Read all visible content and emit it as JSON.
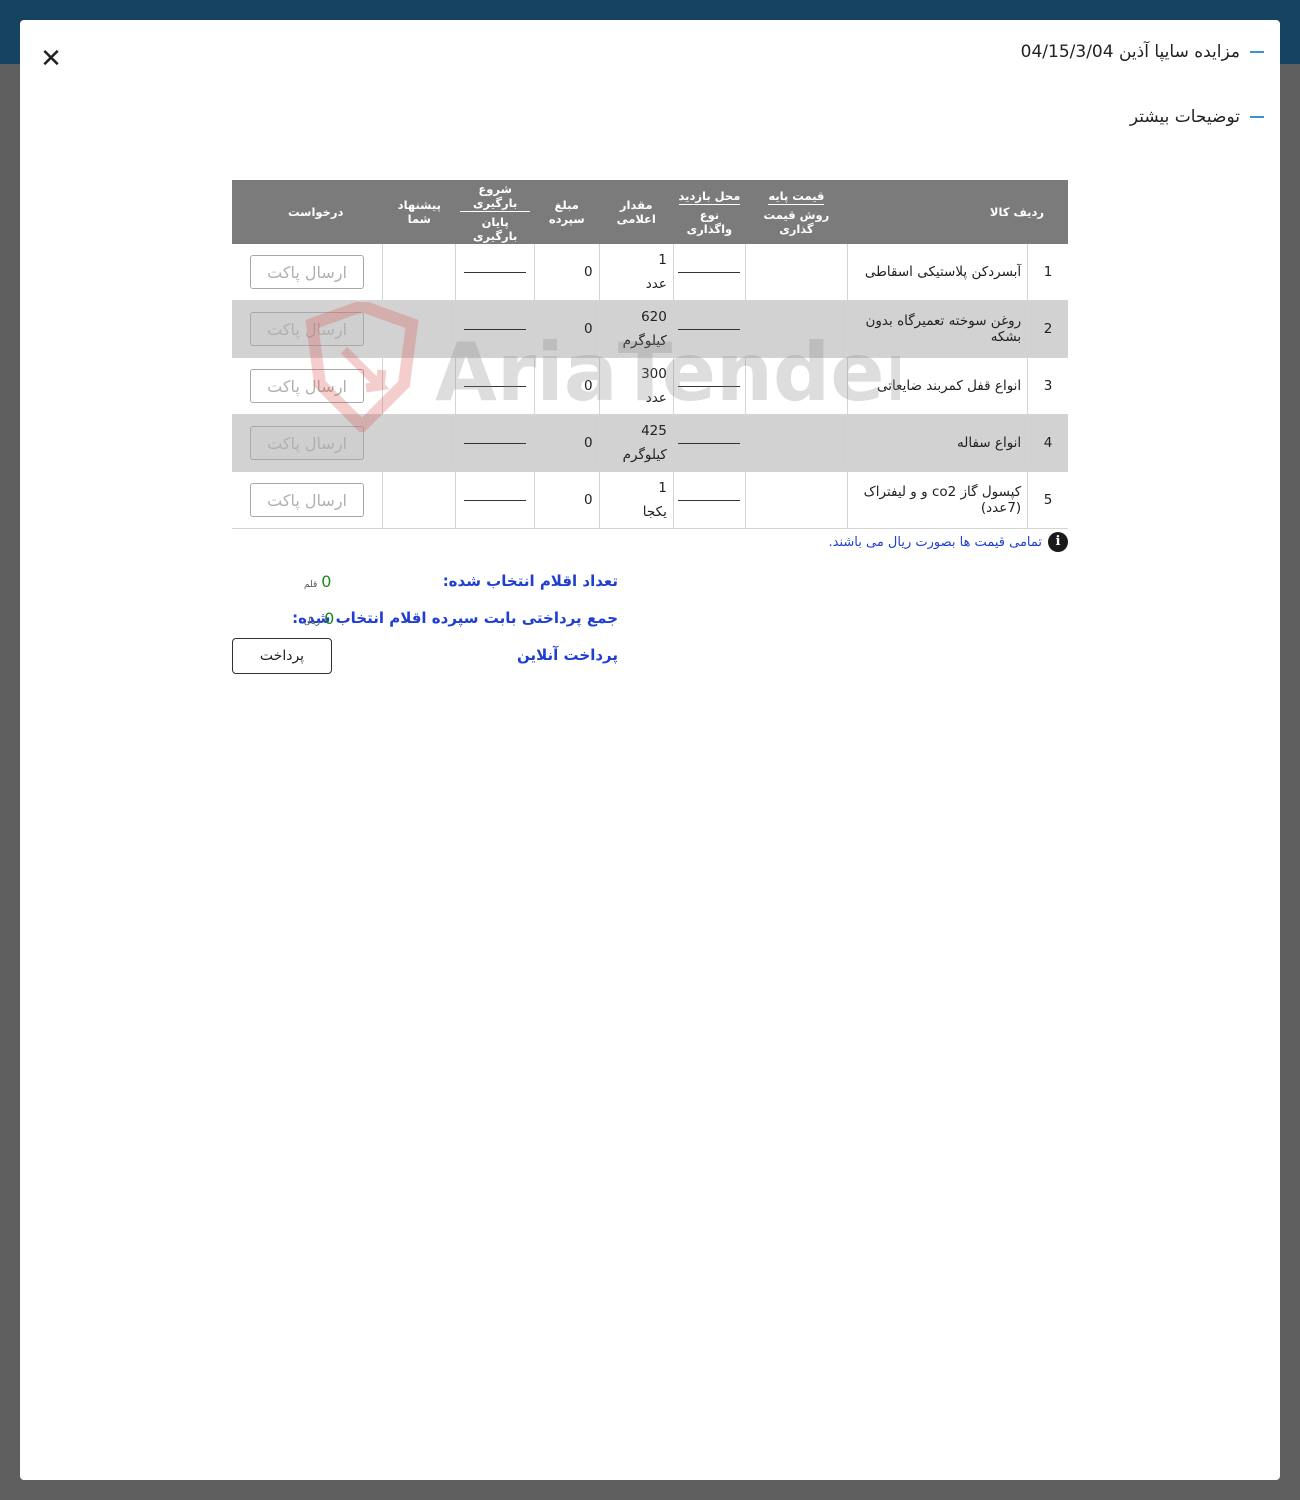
{
  "header": {
    "title": "مزایده سایپا آذین 04/15/3/04",
    "subtitle": "توضیحات بیشتر"
  },
  "table": {
    "headers": {
      "row_item": "ردیف کالا",
      "base_price": "قیمت پایه",
      "pricing_method": "روش قیمت گذاری",
      "visit_place": "محل بازدید",
      "assign_type": "نوع واگذاری",
      "declared_qty": "مقدار اعلامی",
      "deposit": "مبلغ سپرده",
      "load_start": "شروع بارگیری",
      "load_end": "پایان بارگیری",
      "your_offer": "پیشنهاد شما",
      "request": "درخواست"
    },
    "rows": [
      {
        "num": "1",
        "name": "آبسردکن پلاستیکی اسقاطی",
        "qty": "1",
        "unit": "عدد",
        "deposit": "0",
        "button": "ارسال پاکت"
      },
      {
        "num": "2",
        "name": "روغن سوخته تعمیرگاه بدون بشکه",
        "qty": "620",
        "unit": "کیلوگرم",
        "deposit": "0",
        "button": "ارسال پاکت"
      },
      {
        "num": "3",
        "name": "انواع قفل کمربند ضایعاتی",
        "qty": "300",
        "unit": "عدد",
        "deposit": "0",
        "button": "ارسال پاکت"
      },
      {
        "num": "4",
        "name": "انواع سفاله",
        "qty": "425",
        "unit": "کیلوگرم",
        "deposit": "0",
        "button": "ارسال پاکت"
      },
      {
        "num": "5",
        "name": "کپسول گاز co2 و و لیفتراک (7عدد)",
        "qty": "1",
        "unit": "یکجا",
        "deposit": "0",
        "button": "ارسال پاکت"
      }
    ]
  },
  "note": "تمامی قیمت ها بصورت ریال می باشند.",
  "summary": {
    "count_label": "تعداد اقلام انتخاب شده:",
    "count_value": "0",
    "count_unit": "قلم",
    "total_label": "جمع پرداختی بابت سپرده اقلام انتخاب شده:",
    "total_value": "0",
    "total_unit": "ریال",
    "online_label": "پرداخت آنلاین",
    "pay_button": "پرداخت"
  },
  "watermark": "AriaTender.neT",
  "colors": {
    "topbar": "#16435f",
    "header_bg": "#7b7b7b",
    "accent_dash": "#3d8fd6",
    "label_blue": "#1f3fd0",
    "value_green": "#1d8a1d",
    "watermark": "#d9534f"
  }
}
